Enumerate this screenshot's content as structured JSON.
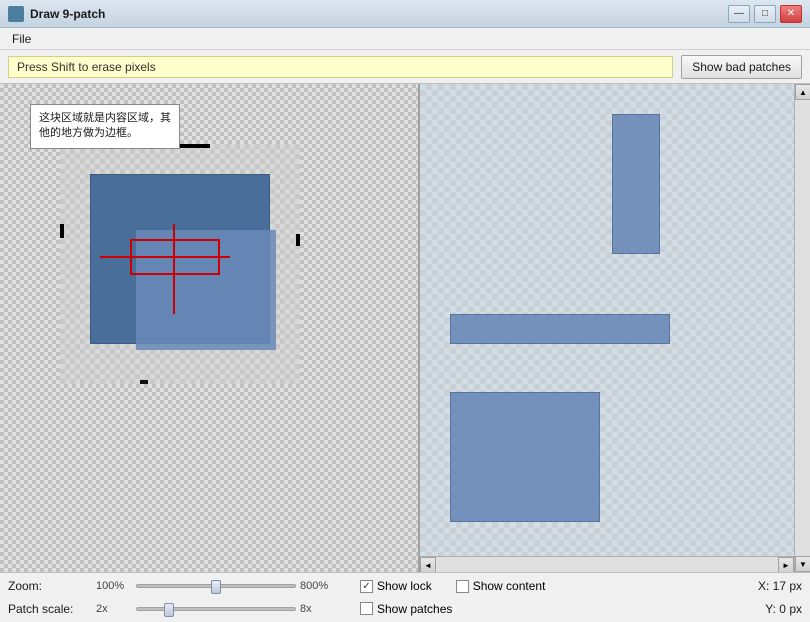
{
  "window": {
    "title": "Draw 9-patch",
    "menu": {
      "file_label": "File"
    }
  },
  "toolbar": {
    "hint_text": "Press Shift to erase pixels",
    "bad_patches_btn": "Show bad patches"
  },
  "callout": {
    "text": "这块区域就是内容区域，其他的地方做为边框。"
  },
  "status": {
    "zoom_label": "Zoom:",
    "zoom_min": "100%",
    "zoom_max": "800%",
    "patch_scale_label": "Patch scale:",
    "patch_scale_min": "2x",
    "patch_scale_max": "8x",
    "show_lock_label": "Show lock",
    "show_content_label": "Show content",
    "show_patches_label": "Show patches",
    "x_coord": "X: 17 px",
    "y_coord": "Y: 0 px"
  },
  "icons": {
    "minimize": "—",
    "maximize": "□",
    "close": "✕",
    "scroll_up": "▲",
    "scroll_down": "▼",
    "scroll_left": "◄",
    "scroll_right": "►"
  }
}
